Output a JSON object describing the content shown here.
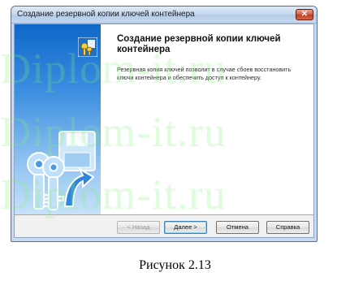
{
  "window": {
    "title": "Создание резервной копии ключей контейнера",
    "close_symbol": "✕"
  },
  "wizard": {
    "heading": "Создание резервной копии ключей контейнера",
    "description": "Резервная копия ключей позволит в случае сбоев восстановить ключи контейнера и обеспечить доступ к контейнеру."
  },
  "buttons": {
    "back": "< Назад",
    "next": "Далее >",
    "cancel": "Отмена",
    "help": "Справка"
  },
  "watermark": "Diplom-it.ru",
  "caption": "Рисунок 2.13"
}
